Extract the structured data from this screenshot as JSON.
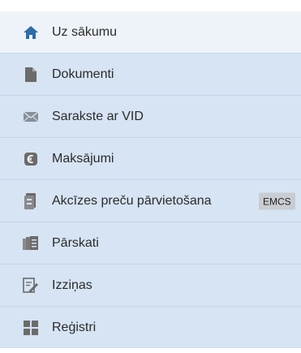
{
  "menu": {
    "items": [
      {
        "label": "Uz sākumu",
        "icon": "home-icon"
      },
      {
        "label": "Dokumenti",
        "icon": "document-icon"
      },
      {
        "label": "Sarakste ar VID",
        "icon": "envelope-icon"
      },
      {
        "label": "Maksājumi",
        "icon": "coin-icon"
      },
      {
        "label": "Akcīzes preču pārvietošana",
        "icon": "files-icon",
        "badge": "EMCS"
      },
      {
        "label": "Pārskati",
        "icon": "reports-icon"
      },
      {
        "label": "Izziņas",
        "icon": "edit-document-icon"
      },
      {
        "label": "Reģistri",
        "icon": "grid-icon"
      }
    ]
  },
  "colors": {
    "active_bg": "#eef3fa",
    "item_bg": "#d6e4f3",
    "separator": "#c4d5e8",
    "icon": "#6b6b6b",
    "badge_bg": "#c9ccd1"
  }
}
